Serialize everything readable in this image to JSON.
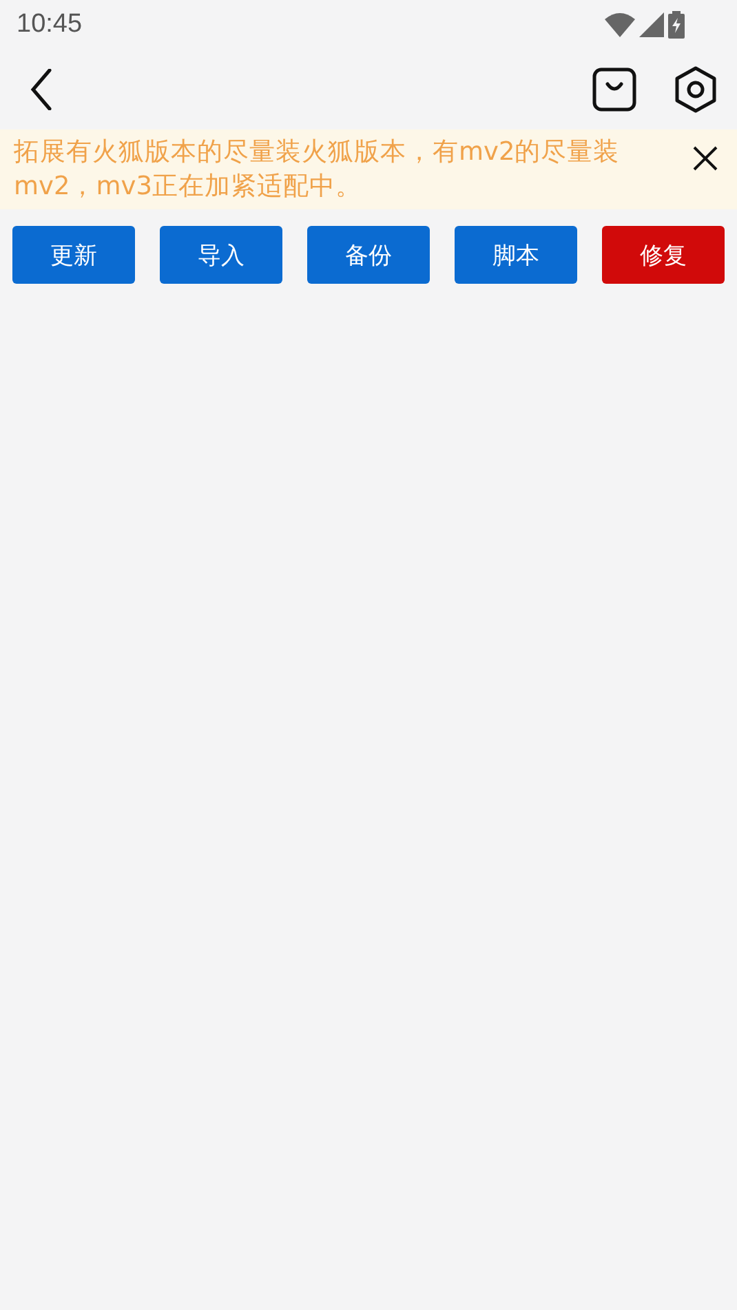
{
  "status_bar": {
    "time": "10:45"
  },
  "notice": {
    "text": "拓展有火狐版本的尽量装火狐版本，有mv2的尽量装mv2，mv3正在加紧适配中。"
  },
  "buttons": [
    {
      "label": "更新",
      "kind": "primary"
    },
    {
      "label": "导入",
      "kind": "primary"
    },
    {
      "label": "备份",
      "kind": "primary"
    },
    {
      "label": "脚本",
      "kind": "primary"
    },
    {
      "label": "修复",
      "kind": "danger"
    }
  ]
}
